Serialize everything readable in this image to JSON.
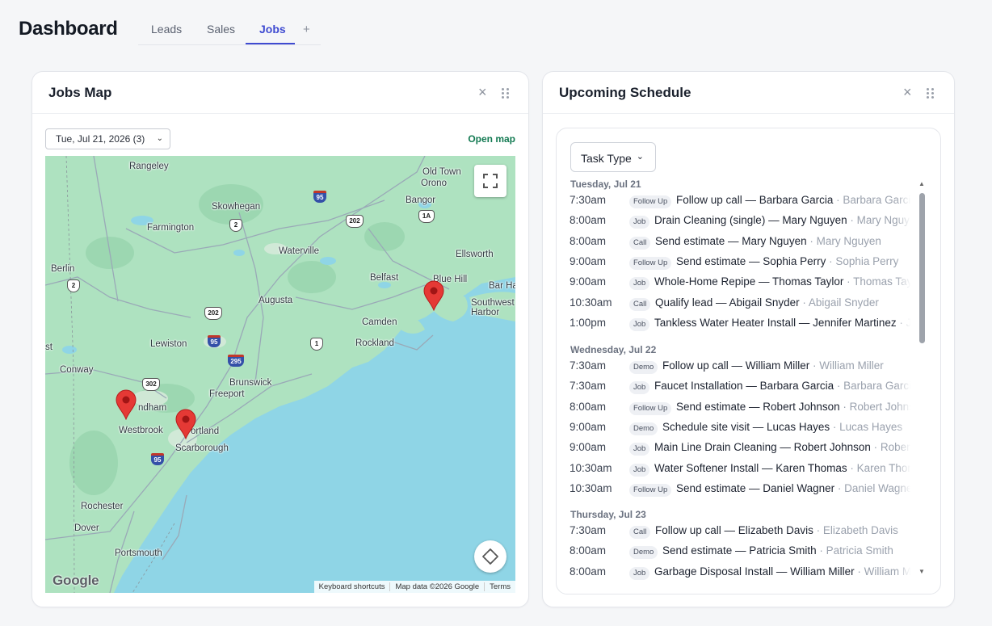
{
  "header": {
    "title": "Dashboard",
    "tabs": [
      "Leads",
      "Sales",
      "Jobs"
    ],
    "active_tab": "Jobs",
    "add_tab": "+"
  },
  "colors": {
    "accent": "#3f4bd1",
    "open_map": "#137a52",
    "pin": "#e53935",
    "water": "#8fd5e6",
    "land": "#aee2c0"
  },
  "jobs_map": {
    "title": "Jobs Map",
    "close": "×",
    "date_select": "Tue, Jul 21, 2026 (3)",
    "open_map": "Open map",
    "google": "Google",
    "attribution": [
      "Keyboard shortcuts",
      "Map data ©2026 Google",
      "Terms"
    ],
    "places": [
      "Rangeley",
      "Old Town",
      "Orono",
      "Bangor",
      "Skowhegan",
      "Farmington",
      "Waterville",
      "Ellsworth",
      "Berlin",
      "Belfast",
      "Blue Hill",
      "Bar Ha",
      "Augusta",
      "Southwest Harbor",
      "Camden",
      "Lewiston",
      "Rockland",
      "Conway",
      "Brunswick",
      "Freeport",
      "ndham",
      "Westbrook",
      "ortland",
      "Scarborough",
      "Rochester",
      "Dover",
      "Portsmouth",
      "st"
    ],
    "route_shields": [
      "95",
      "2",
      "202",
      "1A",
      "2",
      "202",
      "95",
      "1",
      "295",
      "302",
      "95"
    ],
    "pins": 3
  },
  "schedule": {
    "title": "Upcoming Schedule",
    "close": "×",
    "filter_label": "Task Type",
    "days": [
      {
        "label": "Tuesday, Jul 21",
        "items": [
          {
            "time": "7:30am",
            "type": "Follow Up",
            "task": "Follow up call — Barbara Garcia",
            "person": "Barbara Garcia"
          },
          {
            "time": "8:00am",
            "type": "Job",
            "task": "Drain Cleaning (single) — Mary Nguyen",
            "person": "Mary Nguyen"
          },
          {
            "time": "8:00am",
            "type": "Call",
            "task": "Send estimate — Mary Nguyen",
            "person": "Mary Nguyen"
          },
          {
            "time": "9:00am",
            "type": "Follow Up",
            "task": "Send estimate — Sophia Perry",
            "person": "Sophia Perry"
          },
          {
            "time": "9:00am",
            "type": "Job",
            "task": "Whole-Home Repipe — Thomas Taylor",
            "person": "Thomas Taylor"
          },
          {
            "time": "10:30am",
            "type": "Call",
            "task": "Qualify lead — Abigail Snyder",
            "person": "Abigail Snyder"
          },
          {
            "time": "1:00pm",
            "type": "Job",
            "task": "Tankless Water Heater Install — Jennifer Martinez",
            "person": "Jennifer Martinez"
          }
        ]
      },
      {
        "label": "Wednesday, Jul 22",
        "items": [
          {
            "time": "7:30am",
            "type": "Demo",
            "task": "Follow up call — William Miller",
            "person": "William Miller"
          },
          {
            "time": "7:30am",
            "type": "Job",
            "task": "Faucet Installation — Barbara Garcia",
            "person": "Barbara Garcia"
          },
          {
            "time": "8:00am",
            "type": "Follow Up",
            "task": "Send estimate — Robert Johnson",
            "person": "Robert Johnson"
          },
          {
            "time": "9:00am",
            "type": "Demo",
            "task": "Schedule site visit — Lucas Hayes",
            "person": "Lucas Hayes"
          },
          {
            "time": "9:00am",
            "type": "Job",
            "task": "Main Line Drain Cleaning — Robert Johnson",
            "person": "Robert Johnson"
          },
          {
            "time": "10:30am",
            "type": "Job",
            "task": "Water Softener Install — Karen Thomas",
            "person": "Karen Thomas"
          },
          {
            "time": "10:30am",
            "type": "Follow Up",
            "task": "Send estimate — Daniel Wagner",
            "person": "Daniel Wagner"
          }
        ]
      },
      {
        "label": "Thursday, Jul 23",
        "items": [
          {
            "time": "7:30am",
            "type": "Call",
            "task": "Follow up call — Elizabeth Davis",
            "person": "Elizabeth Davis"
          },
          {
            "time": "8:00am",
            "type": "Demo",
            "task": "Send estimate — Patricia Smith",
            "person": "Patricia Smith"
          },
          {
            "time": "8:00am",
            "type": "Job",
            "task": "Garbage Disposal Install — William Miller",
            "person": "William Miller"
          }
        ]
      }
    ]
  }
}
